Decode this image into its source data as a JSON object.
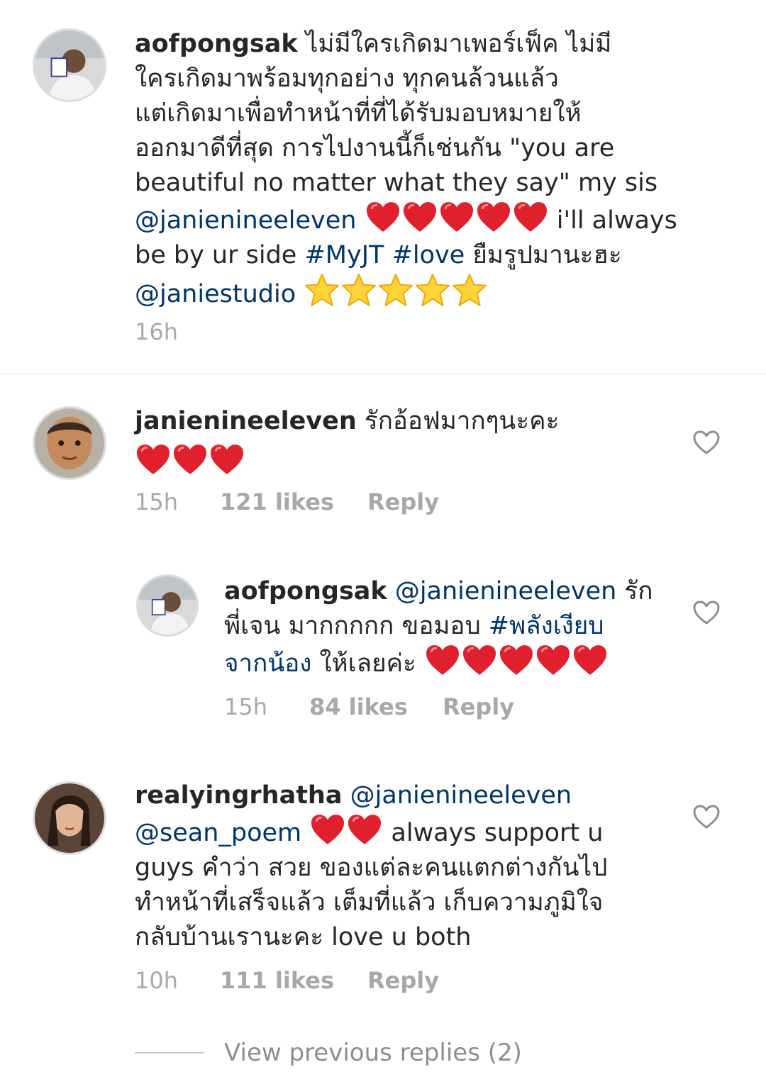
{
  "comments": [
    {
      "username": "aofpongsak",
      "text_1": " ไม่มีใครเกิดมาเพอร์เฟ็ค ไม่มี",
      "text_2": "ใครเกิดมาพร้อมทุกอย่าง ทุกคนล้วนแล้ว",
      "text_3": "แต่เกิดมาเพื่อทำหน้าที่ที่ได้รับมอบหมายให้",
      "text_4": "ออกมาดีที่สุด การไปงานนี้ก็เช่นกัน \"you are",
      "text_5": "beautiful no matter what they say\" my sis",
      "mention_1": "@janienineeleven",
      "text_6": " i'll always",
      "text_7": "be by ur side ",
      "hashtag_1": "#MyJT",
      "hashtag_2": "#love",
      "text_8": " ยืมรูปมานะฮะ",
      "mention_2": "@janiestudio",
      "time": "16h"
    },
    {
      "username": "janienineeleven",
      "text_1": " รักอ้อฟมากๆนะคะ",
      "time": "15h",
      "likes": "121 likes",
      "reply": "Reply"
    },
    {
      "username": "aofpongsak",
      "mention_1": "@janienineeleven",
      "text_1": " รัก",
      "text_2": "พี่เจน มากกกกก ขอมอบ ",
      "hashtag_1a": "#พลังเงียบ",
      "hashtag_1b": "จากน้อง",
      "text_3": " ให้เลยค่ะ",
      "time": "15h",
      "likes": "84 likes",
      "reply": "Reply"
    },
    {
      "username": "realyingrhatha",
      "mention_1": "@janienineeleven",
      "mention_2": "@sean_poem",
      "text_1": " always support u",
      "text_2": "guys คำว่า สวย ของแต่ละคนแตกต่างกันไป",
      "text_3": "ทำหน้าที่เสร็จแล้ว เต็มที่แล้ว เก็บความภูมิใจ",
      "text_4": "กลับบ้านเรานะคะ love u both",
      "time": "10h",
      "likes": "111 likes",
      "reply": "Reply"
    }
  ],
  "view_previous": "View previous replies (2)",
  "colors": {
    "text": "#262626",
    "link": "#003569",
    "meta": "#a8a8a8",
    "heart_emoji": "#e0202c",
    "star_emoji": "#ffd43b"
  },
  "icons": [
    "like-heart-icon",
    "red-heart-emoji",
    "star-emoji"
  ]
}
